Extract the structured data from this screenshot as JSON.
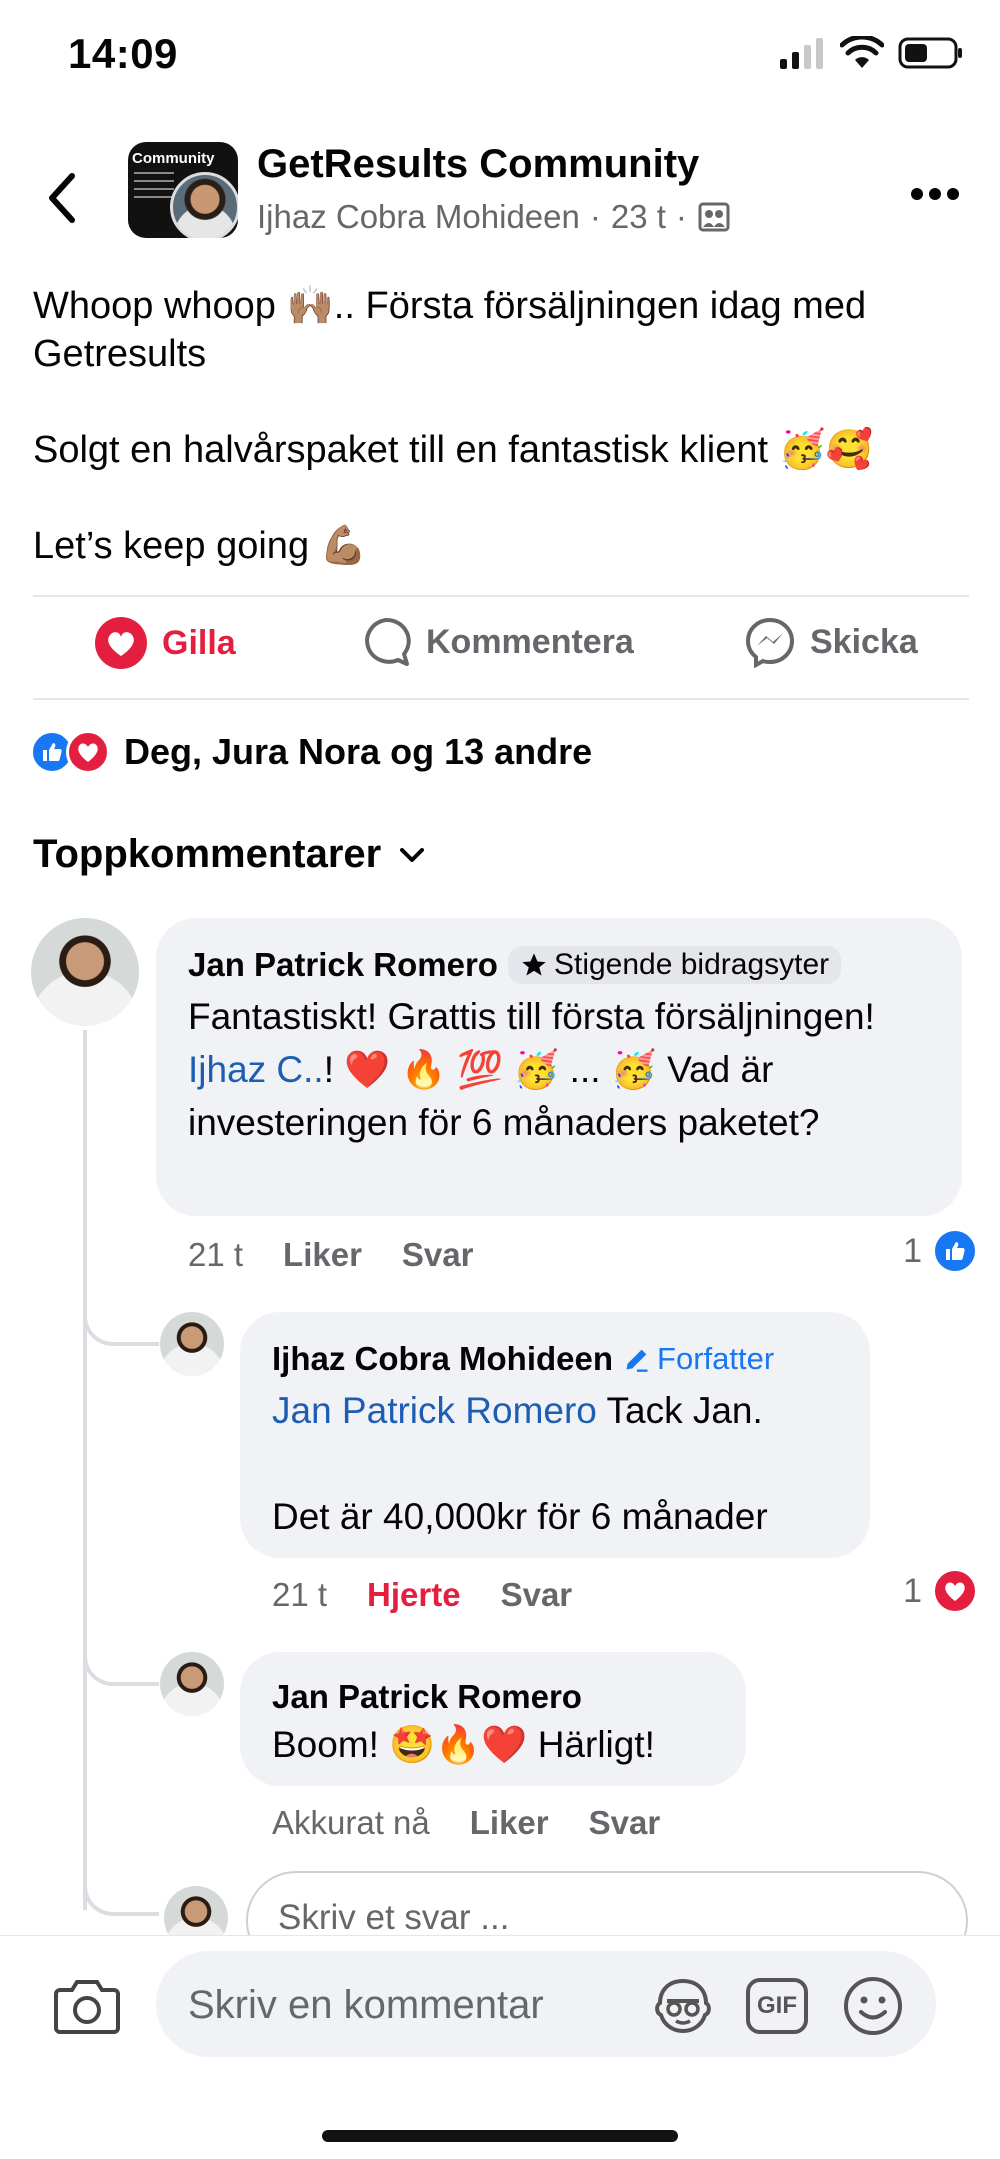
{
  "status_bar": {
    "time": "14:09"
  },
  "header": {
    "group_name": "GetResults Community",
    "avatar_text": "Community",
    "author": "Ijhaz Cobra Mohideen",
    "time": "23 t",
    "separator": "·"
  },
  "post": {
    "line1": "Whoop whoop 🙌🏽.. Första försäljningen idag med Getresults",
    "line2": "Solgt en halvårspaket till en fantastisk klient 🥳🥰",
    "line3": "Let’s keep going 💪🏽"
  },
  "actions": {
    "like": "Gilla",
    "comment": "Kommentera",
    "share": "Skicka"
  },
  "reactions": {
    "summary": "Deg, Jura Nora og 13 andre"
  },
  "comments_header": "Toppkommentarer",
  "comments": [
    {
      "author": "Jan Patrick Romero",
      "badge": "Stigende bidragsyter",
      "text_before": "Fantastiskt! Grattis till första försäljningen! ",
      "mention": "Ijhaz C..",
      "text_after": "! ❤️ 🔥 💯 🥳 ... 🥳 Vad är investeringen för 6 månaders paketet?",
      "time": "21 t",
      "like_label": "Liker",
      "reply_label": "Svar",
      "reaction_count": "1"
    },
    {
      "author": "Ijhaz Cobra Mohideen",
      "badge": "Forfatter",
      "mention": "Jan Patrick Romero",
      "text_after": " Tack Jan.",
      "text_line2": "Det är 40,000kr för 6 månader",
      "time": "21 t",
      "like_label": "Hjerte",
      "reply_label": "Svar",
      "reaction_count": "1"
    },
    {
      "author": "Jan Patrick Romero",
      "text": "Boom! 🤩🔥❤️ Härligt!",
      "time": "Akkurat nå",
      "like_label": "Liker",
      "reply_label": "Svar"
    }
  ],
  "reply_input": {
    "placeholder": "Skriv et svar ..."
  },
  "composer": {
    "placeholder": "Skriv en kommentar",
    "gif_label": "GIF"
  },
  "colors": {
    "like_red": "#e41e3f",
    "link_blue": "#1d5eb3",
    "facebook_blue": "#1877f2",
    "gray_text": "#65676b"
  }
}
